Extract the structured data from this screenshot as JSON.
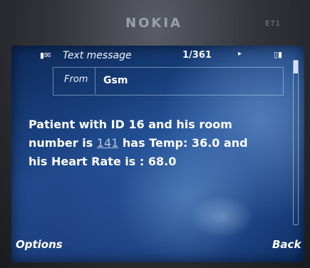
{
  "device": {
    "brand": "NOKIA",
    "model": "E71"
  },
  "header": {
    "icon_glyph": "▮✉",
    "title": "Text message",
    "counter": "1/361",
    "nav_glyph": "▸",
    "status_glyph": "▯▮"
  },
  "from": {
    "label": "From",
    "value": "Gsm"
  },
  "message": {
    "line1": "Patient with ID 16 and his room",
    "line2_pre": "number is ",
    "room_number": "141",
    "line2_post": " has Temp: 36.0 and",
    "line3": "his Heart Rate is : 68.0"
  },
  "softkeys": {
    "left": "Options",
    "right": "Back"
  }
}
